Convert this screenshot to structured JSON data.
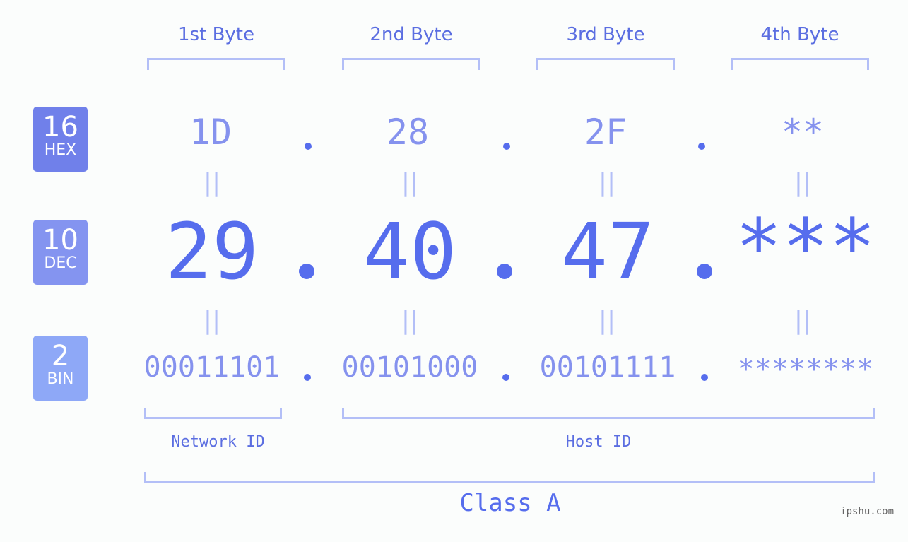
{
  "bases": [
    {
      "num": "16",
      "label": "HEX",
      "color": "#7080ea"
    },
    {
      "num": "10",
      "label": "DEC",
      "color": "#8494f0"
    },
    {
      "num": "2",
      "label": "BIN",
      "color": "#8ea8f7"
    }
  ],
  "bytes": [
    {
      "header": "1st Byte",
      "hex": "1D",
      "dec": "29",
      "bin": "00011101"
    },
    {
      "header": "2nd Byte",
      "hex": "28",
      "dec": "40",
      "bin": "00101000"
    },
    {
      "header": "3rd Byte",
      "hex": "2F",
      "dec": "47",
      "bin": "00101111"
    },
    {
      "header": "4th Byte",
      "hex": "**",
      "dec": "***",
      "bin": "********"
    }
  ],
  "equals_symbol": "||",
  "network_id_label": "Network ID",
  "host_id_label": "Host ID",
  "class_label": "Class A",
  "watermark": "ipshu.com",
  "colors": {
    "accent": "#566ded",
    "light": "#8592ee",
    "bracket": "#b3bff7"
  }
}
